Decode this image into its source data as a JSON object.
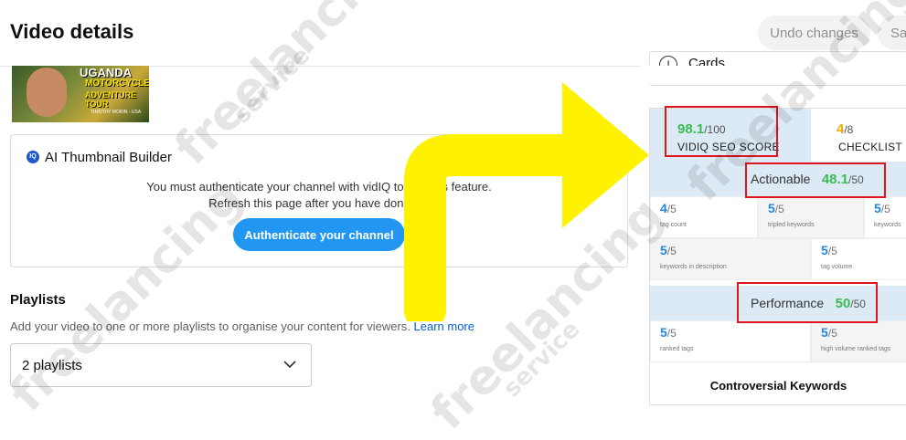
{
  "header": {
    "title": "Video details",
    "undo_label": "Undo changes",
    "save_label": "Sa"
  },
  "thumbnail": {
    "line1": "UGANDA",
    "line2": "MOTORCYCLE",
    "line3": "ADVENTURE TOUR",
    "line4": "TIMOTHY MORIN - USA"
  },
  "ai_builder": {
    "icon_text": "IQ",
    "title": "AI Thumbnail Builder",
    "message_line1": "You must authenticate your channel with vidIQ to use this feature.",
    "message_line2": "Refresh this page after you have done so.",
    "button_label": "Authenticate your channel"
  },
  "playlists": {
    "title": "Playlists",
    "description": "Add your video to one or more playlists to organise your content for viewers.",
    "learn_more": "Learn more",
    "selected_value": "2 playlists"
  },
  "cards": {
    "label": "Cards"
  },
  "seo_panel": {
    "score": "98.1",
    "score_max": "/100",
    "score_label": "VIDIQ SEO SCORE",
    "checklist_value": "4",
    "checklist_max": "/8",
    "checklist_label": "CHECKLIST",
    "actionable": {
      "label": "Actionable",
      "value": "48.1",
      "max": "/50"
    },
    "actionable_cells": [
      {
        "value": "4",
        "max": "/5",
        "label": "tag count"
      },
      {
        "value": "5",
        "max": "/5",
        "label": "tripled keywords"
      },
      {
        "value": "5",
        "max": "/5",
        "label": "keywords"
      },
      {
        "value": "5",
        "max": "/5",
        "label": "keywords in description"
      },
      {
        "value": "5",
        "max": "/5",
        "label": "tag volume"
      }
    ],
    "performance": {
      "label": "Performance",
      "value": "50",
      "max": "/50"
    },
    "performance_cells": [
      {
        "value": "5",
        "max": "/5",
        "label": "ranked tags"
      },
      {
        "value": "5",
        "max": "/5",
        "label": "high volume ranked tags"
      }
    ],
    "controversial_title": "Controversial Keywords"
  },
  "watermark": {
    "text": "freelancing",
    "subtext": "service"
  },
  "colors": {
    "green": "#3cba54",
    "blue": "#1e88e5",
    "yellow_arrow": "#fff200",
    "red": "#e0141e"
  }
}
